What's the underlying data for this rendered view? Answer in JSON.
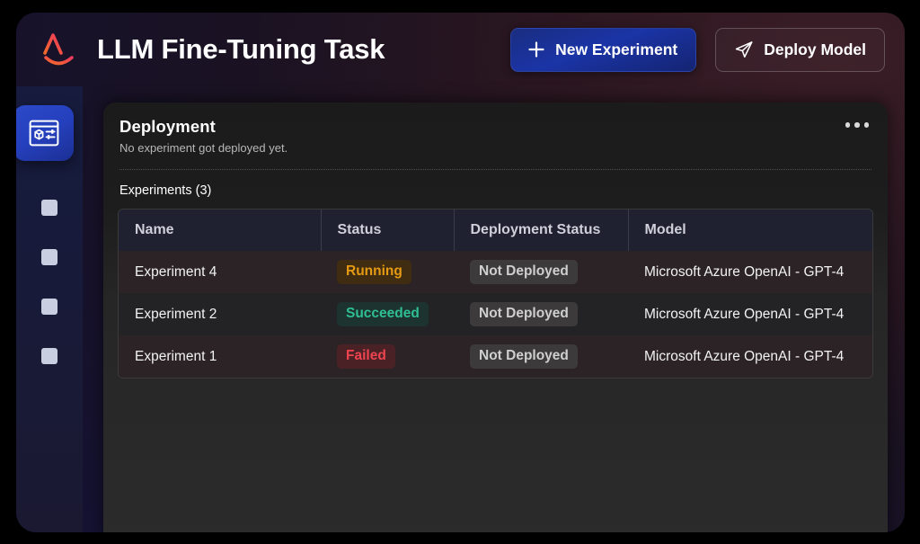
{
  "header": {
    "logo_name": "ai-logo",
    "title": "LLM Fine-Tuning Task",
    "primary_button": {
      "label": "New Experiment",
      "icon": "plus-icon"
    },
    "secondary_button": {
      "label": "Deploy Model",
      "icon": "send-icon"
    }
  },
  "sidebar": {
    "active_item": {
      "icon": "model-settings-icon",
      "name": "sidebar-item-experiments"
    },
    "placeholders": 4
  },
  "panel": {
    "title": "Deployment",
    "subtitle": "No experiment got deployed yet.",
    "menu_icon": "more-options-icon",
    "section_label": "Experiments (3)"
  },
  "table": {
    "columns": [
      "Name",
      "Status",
      "Deployment Status",
      "Model"
    ],
    "rows": [
      {
        "name": "Experiment 4",
        "status": "Running",
        "status_kind": "running",
        "deployment_status": "Not Deployed",
        "model": "Microsoft Azure OpenAI - GPT-4"
      },
      {
        "name": "Experiment 2",
        "status": "Succeeded",
        "status_kind": "succeeded",
        "deployment_status": "Not Deployed",
        "model": "Microsoft Azure OpenAI - GPT-4"
      },
      {
        "name": "Experiment 1",
        "status": "Failed",
        "status_kind": "failed",
        "deployment_status": "Not Deployed",
        "model": "Microsoft Azure OpenAI - GPT-4"
      }
    ]
  },
  "colors": {
    "accent_blue": "#2540bd",
    "logo_orange": "#f2622c",
    "logo_pink": "#f0405a",
    "status_running": "#e59a14",
    "status_succeeded": "#2fbf93",
    "status_failed": "#ef4450",
    "panel_bg": "#232323"
  }
}
